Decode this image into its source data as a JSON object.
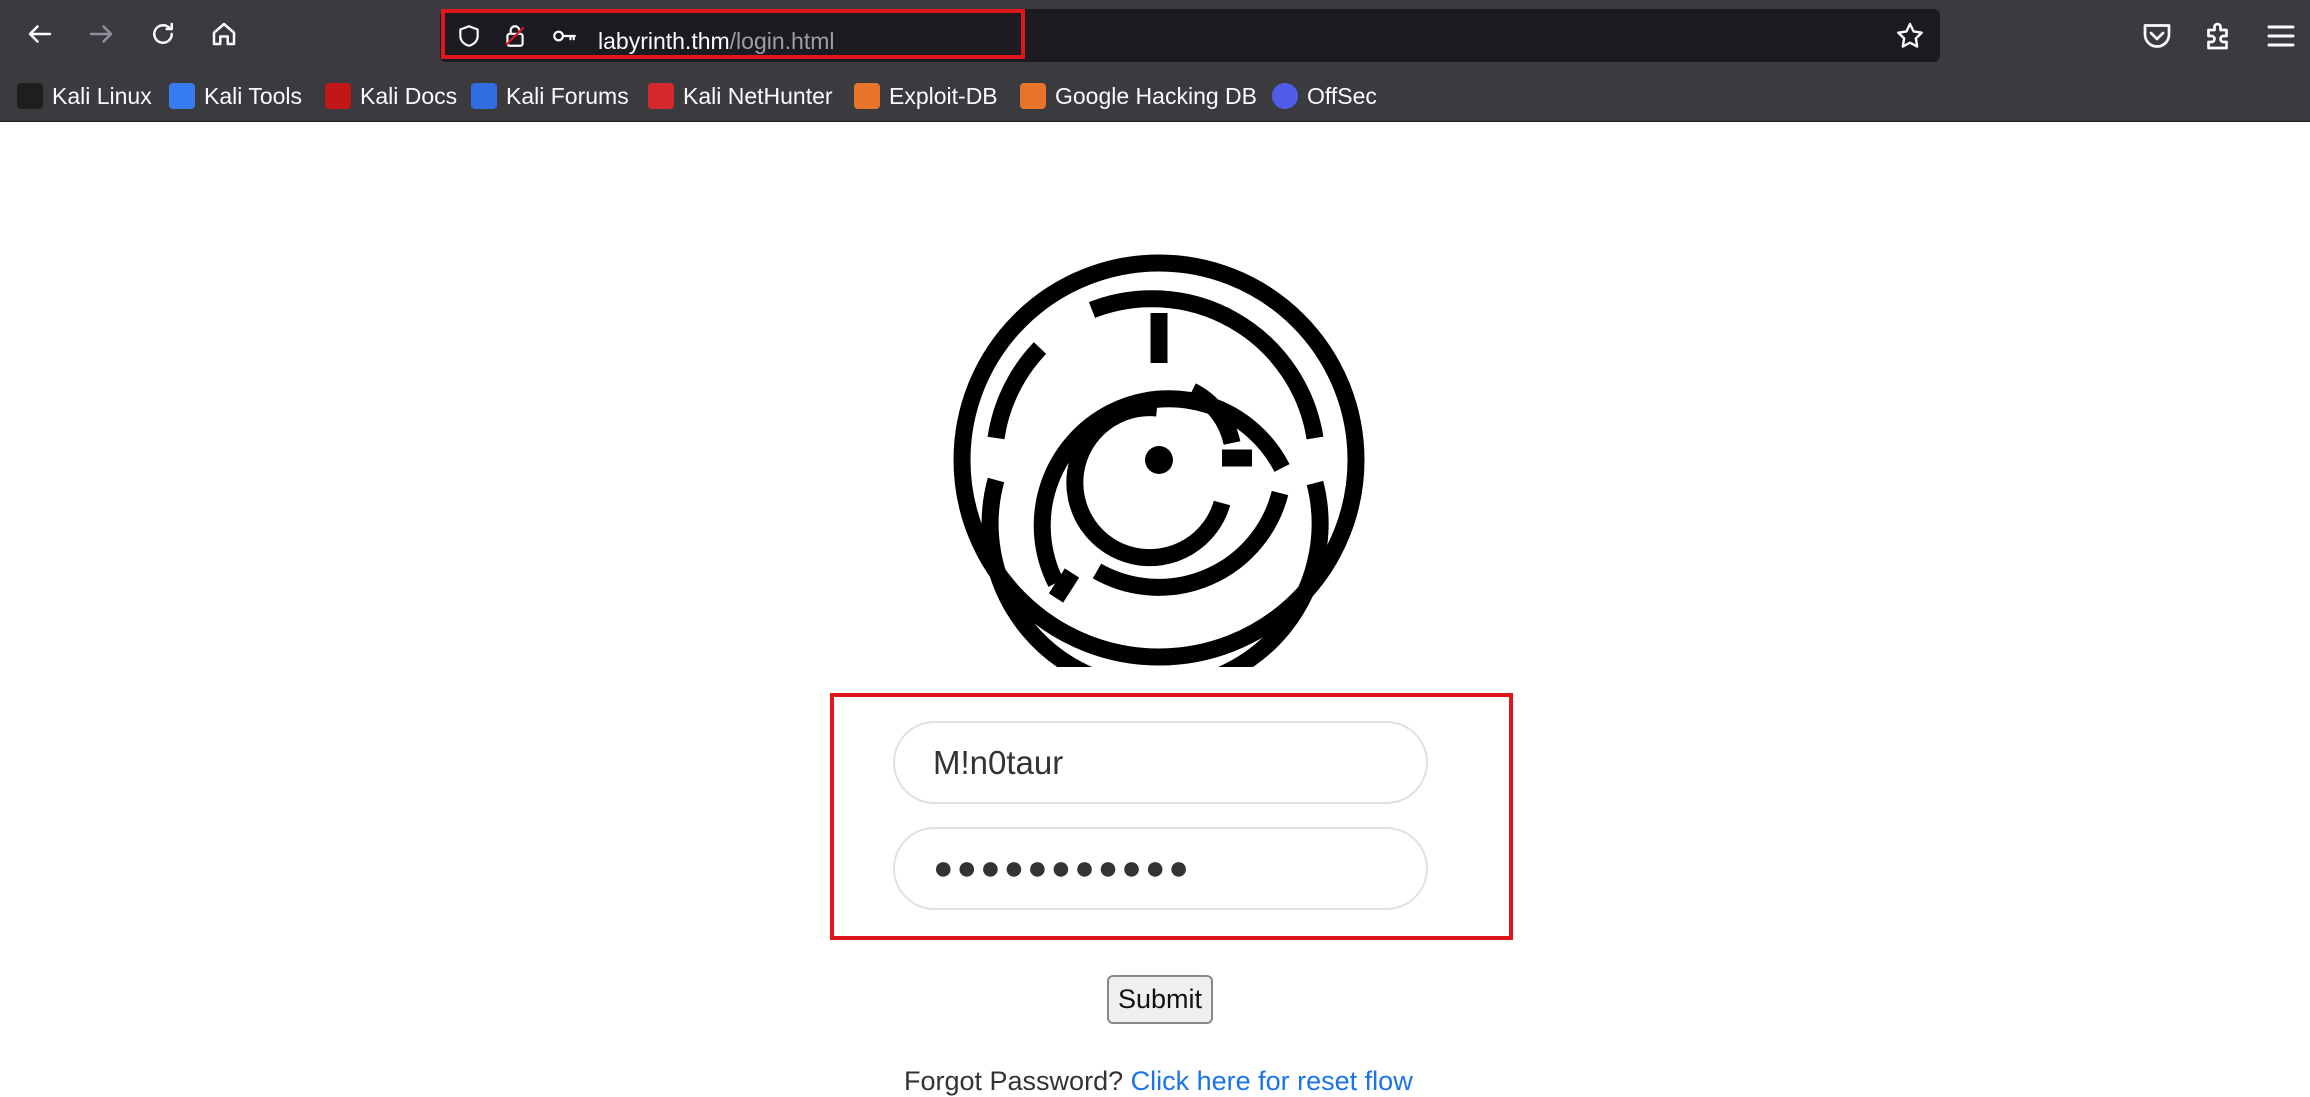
{
  "browser": {
    "url_host": "labyrinth.thm",
    "url_path": "/login.html",
    "bookmarks": [
      {
        "label": "Kali Linux",
        "icon": "kali-dragon-icon",
        "color": "#1e1e1e"
      },
      {
        "label": "Kali Tools",
        "icon": "kali-tools-icon",
        "color": "#367bf0"
      },
      {
        "label": "Kali Docs",
        "icon": "kali-docs-icon",
        "color": "#c21717"
      },
      {
        "label": "Kali Forums",
        "icon": "kali-forums-icon",
        "color": "#2f6de1"
      },
      {
        "label": "Kali NetHunter",
        "icon": "nethunter-icon",
        "color": "#d4282d"
      },
      {
        "label": "Exploit-DB",
        "icon": "exploit-db-icon",
        "color": "#e8742a"
      },
      {
        "label": "Google Hacking DB",
        "icon": "ghdb-icon",
        "color": "#e8742a"
      },
      {
        "label": "OffSec",
        "icon": "offsec-icon",
        "color": "#4f5de8"
      }
    ]
  },
  "login": {
    "username_value": "M!n0taur",
    "password_mask": "●●●●●●●●●●●",
    "submit_label": "Submit",
    "forgot_text": "Forgot Password? ",
    "forgot_link": "Click here for reset flow"
  },
  "colors": {
    "highlight": "#e0161d",
    "toolbar": "#3b3b3f",
    "urlbar": "#1c1b22"
  }
}
